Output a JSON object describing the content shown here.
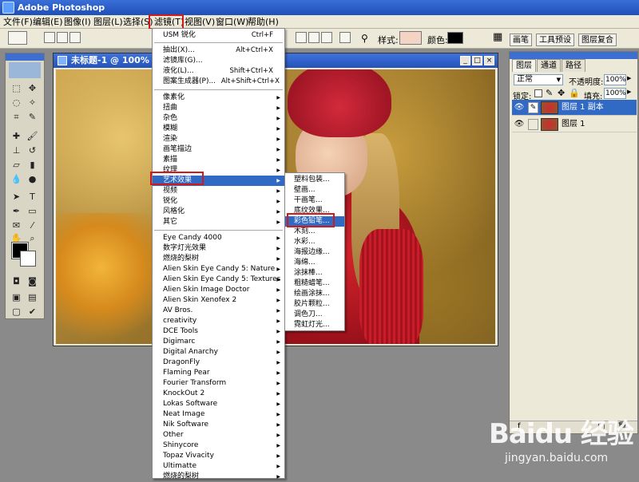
{
  "title_bar": {
    "app_title": "Adobe Photoshop"
  },
  "menubar": [
    "文件(F)",
    "编辑(E)",
    "图像(I)",
    "图层(L)",
    "选择(S)",
    "滤镜(T)",
    "视图(V)",
    "窗口(W)",
    "帮助(H)"
  ],
  "options_bar": {
    "style_label": "样式:",
    "color_label": "颜色:"
  },
  "palette_well": [
    "画笔",
    "工具预设",
    "图层复合"
  ],
  "document": {
    "title": "未标题-1 @ 100% (图层"
  },
  "filter_menu": {
    "group1": [
      {
        "label": "USM 锐化",
        "shortcut": "Ctrl+F"
      }
    ],
    "group2": [
      {
        "label": "抽出(X)...",
        "shortcut": "Alt+Ctrl+X"
      },
      {
        "label": "滤镜库(G)...",
        "shortcut": ""
      },
      {
        "label": "液化(L)...",
        "shortcut": "Shift+Ctrl+X"
      },
      {
        "label": "图案生成器(P)...",
        "shortcut": "Alt+Shift+Ctrl+X"
      }
    ],
    "group3": [
      "像素化",
      "扭曲",
      "杂色",
      "模糊",
      "渲染",
      "画笔描边",
      "素描",
      "纹理",
      "艺术效果",
      "视频",
      "锐化",
      "风格化",
      "其它"
    ],
    "group4": [
      "Eye Candy 4000",
      "数字灯光效果",
      "燃烧的梨树",
      "Alien Skin Eye Candy 5: Nature",
      "Alien Skin Eye Candy 5: Textures",
      "Alien Skin Image Doctor",
      "Alien Skin Xenofex 2",
      "AV Bros.",
      "creativity",
      "DCE Tools",
      "Digimarc",
      "Digital Anarchy",
      "DragonFly",
      "Flaming Pear",
      "Fourier Transform",
      "KnockOut 2",
      "Lokas Software",
      "Neat Image",
      "Nik Software",
      "Other",
      "Shinycore",
      "Topaz Vivacity",
      "Ultimatte",
      "燃烧的梨树"
    ],
    "selected_item": "艺术效果"
  },
  "artistic_submenu": {
    "items": [
      "塑料包装...",
      "壁画...",
      "干画笔...",
      "底纹效果...",
      "彩色铅笔...",
      "木刻...",
      "水彩...",
      "海报边缘...",
      "海绵...",
      "涂抹棒...",
      "粗糙蜡笔...",
      "绘画涂抹...",
      "胶片颗粒...",
      "调色刀...",
      "霓虹灯光..."
    ],
    "selected_item": "彩色铅笔..."
  },
  "layers_panel": {
    "tabs": [
      "图层",
      "通道",
      "路径"
    ],
    "blend_mode": "正常",
    "opacity_label": "不透明度:",
    "opacity_value": "100%",
    "lock_label": "锁定:",
    "fill_label": "填充:",
    "fill_value": "100%",
    "layers": [
      {
        "name": "图层 1 副本",
        "selected": true
      },
      {
        "name": "图层 1",
        "selected": false
      }
    ]
  },
  "watermark": {
    "logo": "Baidu 经验",
    "url": "jingyan.baidu.com"
  },
  "colors": {
    "highlight_red": "#d21a1a",
    "selection_blue": "#316ac5",
    "xp_blue": "#3a6fd8"
  }
}
